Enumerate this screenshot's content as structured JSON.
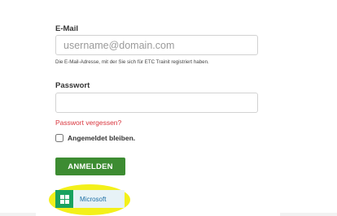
{
  "form": {
    "email_label": "E-Mail",
    "email_placeholder": "username@domain.com",
    "email_help": "Die E-Mail-Adresse, mit der Sie sich für ETC Trainit registriert haben.",
    "password_label": "Passwort",
    "password_placeholder": "",
    "forgot_password": "Passwort vergessen?",
    "remember_me": "Angemeldet bleiben.",
    "login_button": "ANMELDEN",
    "microsoft_button": "Microsoft"
  },
  "colors": {
    "login_button": "#3d8c32",
    "forgot_link": "#d9363e",
    "microsoft_icon_bg": "#1aa260",
    "microsoft_button_bg": "#e7f2f7",
    "highlight": "#f3f01a"
  },
  "icons": {
    "microsoft": "windows-logo-icon"
  }
}
